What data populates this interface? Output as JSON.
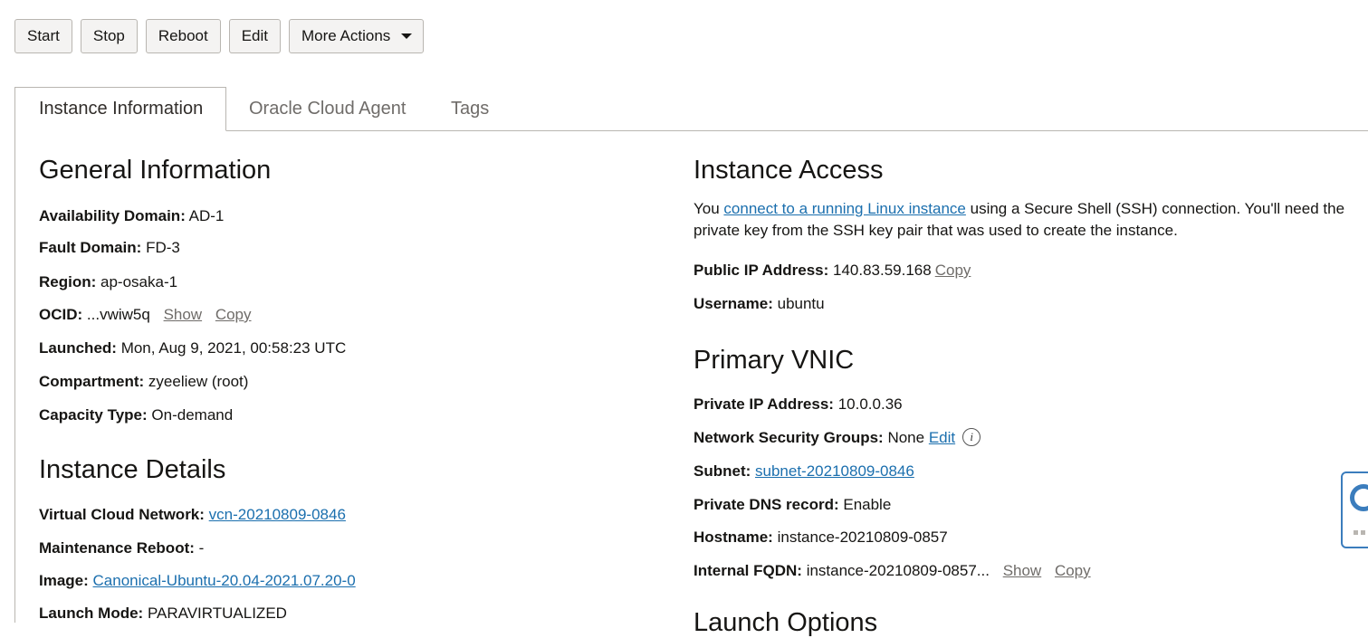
{
  "toolbar": {
    "start": "Start",
    "stop": "Stop",
    "reboot": "Reboot",
    "edit": "Edit",
    "more_actions": "More Actions"
  },
  "tabs": [
    {
      "label": "Instance Information",
      "active": true
    },
    {
      "label": "Oracle Cloud Agent",
      "active": false
    },
    {
      "label": "Tags",
      "active": false
    }
  ],
  "general": {
    "heading": "General Information",
    "availability_domain": {
      "label": "Availability Domain:",
      "value": "AD-1"
    },
    "fault_domain": {
      "label": "Fault Domain:",
      "value": "FD-3"
    },
    "region": {
      "label": "Region:",
      "value": "ap-osaka-1"
    },
    "ocid": {
      "label": "OCID:",
      "value": "...vwiw5q",
      "show": "Show",
      "copy": "Copy"
    },
    "launched": {
      "label": "Launched:",
      "value": "Mon, Aug 9, 2021, 00:58:23 UTC"
    },
    "compartment": {
      "label": "Compartment:",
      "value": "zyeeliew (root)"
    },
    "capacity_type": {
      "label": "Capacity Type:",
      "value": "On-demand"
    }
  },
  "details": {
    "heading": "Instance Details",
    "vcn": {
      "label": "Virtual Cloud Network:",
      "value": "vcn-20210809-0846"
    },
    "maintenance_reboot": {
      "label": "Maintenance Reboot:",
      "value": "-"
    },
    "image": {
      "label": "Image:",
      "value": "Canonical-Ubuntu-20.04-2021.07.20-0"
    },
    "launch_mode": {
      "label": "Launch Mode:",
      "value": "PARAVIRTUALIZED"
    }
  },
  "access": {
    "heading": "Instance Access",
    "intro_pre": "You ",
    "intro_link": "connect to a running Linux instance",
    "intro_post": " using a Secure Shell (SSH) connection. You'll need the private key from the SSH key pair that was used to create the instance.",
    "public_ip": {
      "label": "Public IP Address:",
      "value": "140.83.59.168",
      "copy": "Copy"
    },
    "username": {
      "label": "Username:",
      "value": "ubuntu"
    }
  },
  "vnic": {
    "heading": "Primary VNIC",
    "private_ip": {
      "label": "Private IP Address:",
      "value": "10.0.0.36"
    },
    "nsg": {
      "label": "Network Security Groups:",
      "value": "None",
      "edit": "Edit",
      "info_glyph": "i"
    },
    "subnet": {
      "label": "Subnet:",
      "value": "subnet-20210809-0846"
    },
    "private_dns": {
      "label": "Private DNS record:",
      "value": "Enable"
    },
    "hostname": {
      "label": "Hostname:",
      "value": "instance-20210809-0857"
    },
    "fqdn": {
      "label": "Internal FQDN:",
      "value": "instance-20210809-0857...",
      "show": "Show",
      "copy": "Copy"
    }
  },
  "next_heading": "Launch Options",
  "colors": {
    "link": "#1b6fae",
    "border": "#b9b6b1",
    "button_bg": "#f4f3f2",
    "help_accent": "#3b7dbd"
  },
  "icons": [
    "caret-down-icon",
    "info-icon",
    "help-lifebuoy-icon",
    "drag-handle-icon"
  ]
}
